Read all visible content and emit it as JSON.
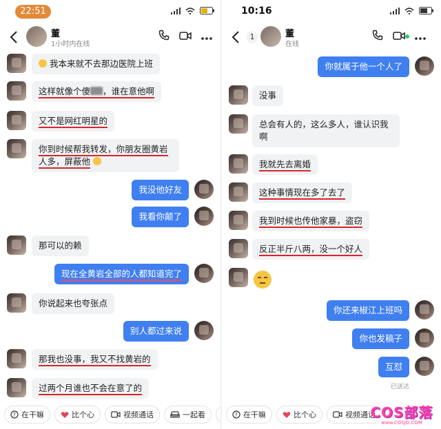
{
  "left": {
    "status_time": "22:51",
    "contact_name": "董",
    "contact_status": "1小时内在线",
    "messages": [
      {
        "side": "in",
        "text": "我本来就不去那边医院上班"
      },
      {
        "side": "in",
        "text_a": "这样就像个傻",
        "text_b": "，谁在意他啊"
      },
      {
        "side": "in",
        "text": "又不是网红明星的"
      },
      {
        "side": "in",
        "text": "你到时候帮我转发，你朋友圈黄岩人多，屏蔽他"
      },
      {
        "side": "out",
        "text": "我没他好友"
      },
      {
        "side": "out",
        "text": "我看你颠了"
      },
      {
        "side": "in",
        "text": "那可以的赖"
      },
      {
        "side": "out",
        "text": "现在全黄岩全部的人都知道完了"
      },
      {
        "side": "in",
        "text": "你说起来也夸张点"
      },
      {
        "side": "out",
        "text": "别人都过来说"
      },
      {
        "side": "in",
        "text": "那我也没事，我又不找黄岩的"
      },
      {
        "side": "in",
        "text": "过两个月谁也不会在意了的"
      }
    ],
    "toolbar": [
      "在干嘛",
      "比个心",
      "视频通话",
      "一起看"
    ]
  },
  "right": {
    "status_time": "10:16",
    "unread_count": "1",
    "contact_name": "董",
    "contact_status": "在线",
    "messages": [
      {
        "side": "out",
        "text": "你就属于他一个人了"
      },
      {
        "side": "in",
        "text": "没事"
      },
      {
        "side": "in",
        "text": "总会有人的，这么多人，谁认识我啊"
      },
      {
        "side": "in",
        "text": "我就先去离婚"
      },
      {
        "side": "in",
        "text": "这种事情现在多了去了"
      },
      {
        "side": "in",
        "text": "我到时候也传他家暴，盗窃"
      },
      {
        "side": "in",
        "text": "反正半斤八两，没一个好人"
      },
      {
        "side": "out",
        "text": "你还来椒江上班吗"
      },
      {
        "side": "out",
        "text": "你也发稿子"
      },
      {
        "side": "out",
        "text": "互怼"
      }
    ],
    "read_receipt": "已送达",
    "toolbar": [
      "在干嘛",
      "比个心",
      "视频通话"
    ]
  },
  "watermark": {
    "big": "COS部落",
    "small": "www.COSJD.COM"
  },
  "colors": {
    "bubble_out": "#3f7ff0",
    "bubble_in": "#f1f2f4",
    "underline": "#d8252b",
    "time_pill": "#e28a3a"
  }
}
